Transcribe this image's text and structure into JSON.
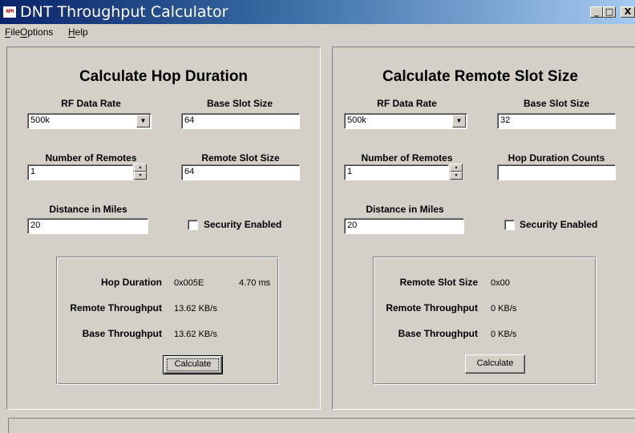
{
  "window": {
    "title": "DNT Throughput Calculator",
    "icon_label": "RFM",
    "minimize_glyph": "_",
    "maximize_glyph": "□",
    "close_glyph": "X"
  },
  "menu": {
    "file": {
      "mnemonic": "F",
      "rest": "ile"
    },
    "options": {
      "mnemonic": "O",
      "rest": "ptions"
    },
    "help": {
      "mnemonic": "H",
      "rest": "elp"
    }
  },
  "left_panel": {
    "title": "Calculate Hop Duration",
    "rf_data_rate_label": "RF Data Rate",
    "rf_data_rate_value": "500k",
    "base_slot_size_label": "Base Slot Size",
    "base_slot_size_value": "64",
    "num_remotes_label": "Number of Remotes",
    "num_remotes_value": "1",
    "remote_slot_size_label": "Remote Slot Size",
    "remote_slot_size_value": "64",
    "distance_label": "Distance in Miles",
    "distance_value": "20",
    "security_label": "Security Enabled",
    "security_checked": false,
    "results": {
      "hop_duration_label": "Hop Duration",
      "hop_duration_hex": "0x005E",
      "hop_duration_ms": "4.70 ms",
      "remote_throughput_label": "Remote Throughput",
      "remote_throughput_value": "13.62 KB/s",
      "base_throughput_label": "Base Throughput",
      "base_throughput_value": "13.62 KB/s"
    },
    "calculate_label": "Calculate"
  },
  "right_panel": {
    "title": "Calculate Remote Slot Size",
    "rf_data_rate_label": "RF Data Rate",
    "rf_data_rate_value": "500k",
    "base_slot_size_label": "Base Slot Size",
    "base_slot_size_value": "32",
    "num_remotes_label": "Number of Remotes",
    "num_remotes_value": "1",
    "hop_duration_counts_label": "Hop Duration Counts",
    "hop_duration_counts_value": "",
    "distance_label": "Distance in Miles",
    "distance_value": "20",
    "security_label": "Security Enabled",
    "security_checked": false,
    "results": {
      "remote_slot_size_label": "Remote Slot Size",
      "remote_slot_size_value": "0x00",
      "remote_throughput_label": "Remote Throughput",
      "remote_throughput_value": "0 KB/s",
      "base_throughput_label": "Base Throughput",
      "base_throughput_value": "0 KB/s"
    },
    "calculate_label": "Calculate"
  },
  "icons": {
    "dropdown": "▼",
    "spin_up": "▲",
    "spin_down": "▼"
  }
}
